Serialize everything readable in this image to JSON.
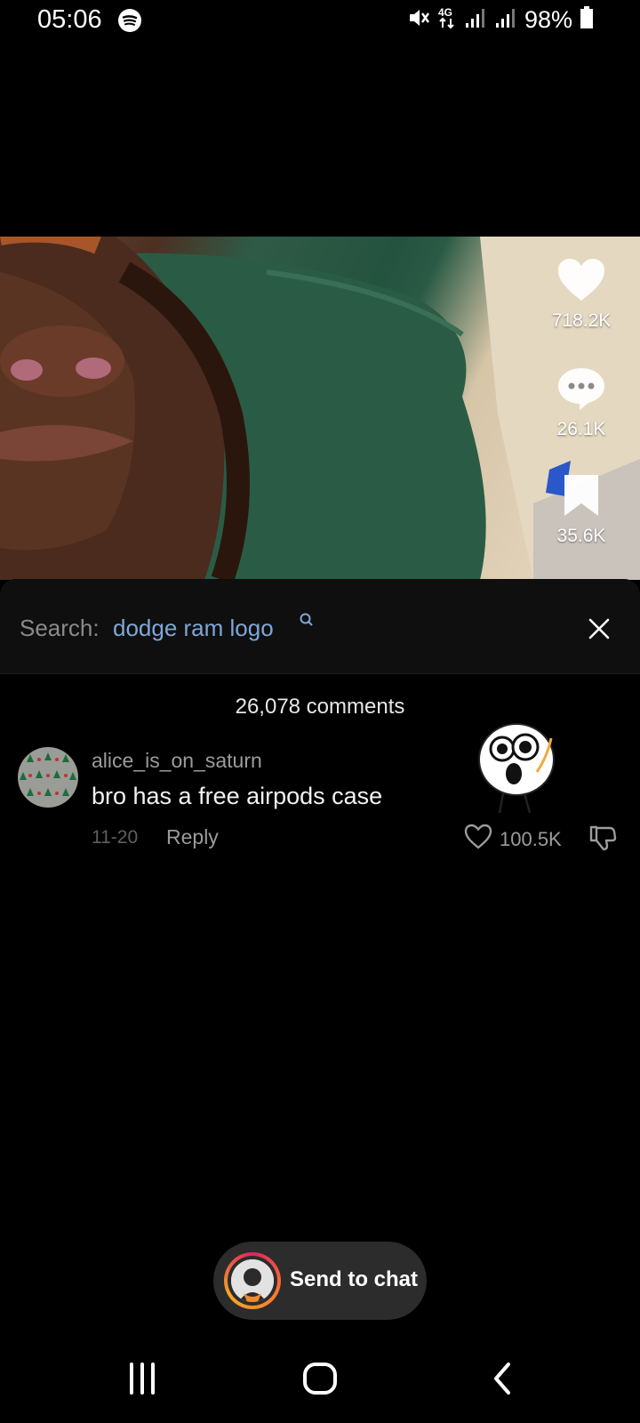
{
  "status": {
    "time": "05:06",
    "battery": "98%",
    "icons": [
      "spotify-icon",
      "mute-icon",
      "4g-icon",
      "signal-icon",
      "signal-icon",
      "battery-icon"
    ]
  },
  "video": {
    "actions": [
      {
        "icon": "heart-icon",
        "count": "718.2K"
      },
      {
        "icon": "comment-icon",
        "count": "26.1K"
      },
      {
        "icon": "bookmark-icon",
        "count": "35.6K"
      }
    ]
  },
  "search": {
    "label": "Search:",
    "term": "dodge ram logo",
    "close_icon": "close-icon"
  },
  "comments": {
    "count_label": "26,078 comments",
    "items": [
      {
        "username": "alice_is_on_saturn",
        "text": "bro has a free airpods case",
        "date": "11-20",
        "reply_label": "Reply",
        "likes": "100.5K"
      }
    ]
  },
  "send_to_chat": {
    "label": "Send to chat"
  },
  "nav": {
    "buttons": [
      "recent-apps-icon",
      "home-icon",
      "back-icon"
    ]
  }
}
